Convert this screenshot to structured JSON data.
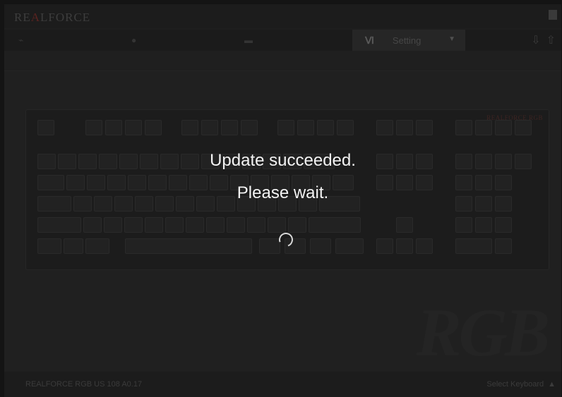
{
  "app": {
    "brand": {
      "prefix": "RE",
      "accent": "A",
      "suffix": "LFORCE"
    },
    "tabs": [
      {
        "label": "",
        "icon": "gamepad-icon"
      },
      {
        "label": "",
        "icon": "lighting-icon"
      },
      {
        "label": "",
        "icon": "keyboard-icon"
      },
      {
        "label": "Setting",
        "icon": "tools-icon",
        "active": true
      }
    ],
    "io": {
      "import_icon": "⇩",
      "export_icon": "⇧"
    }
  },
  "keyboard": {
    "brand": "REALFORCE RGB",
    "watermark": "RGB"
  },
  "status": {
    "model": "REALFORCE RGB US 108  A0.17",
    "select_keyboard": "Select Keyboard",
    "select_arrow": "▲"
  },
  "overlay": {
    "line1": "Update succeeded.",
    "line2": "Please wait."
  },
  "colors": {
    "accent": "#5a2320",
    "overlay_text": "#f3f3f3"
  }
}
